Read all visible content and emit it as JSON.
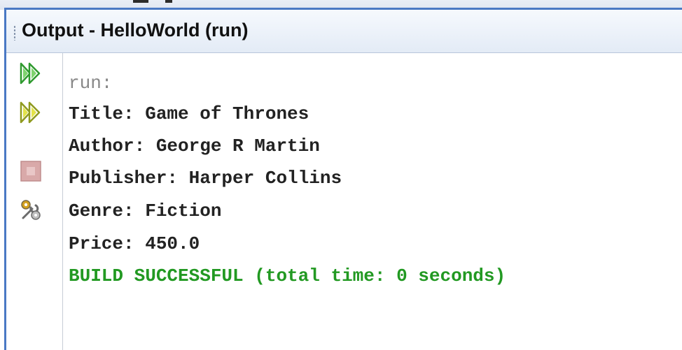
{
  "window": {
    "title": "Output - HelloWorld (run)"
  },
  "toolbar": {
    "rerun_icon": "double-chevron-right-green",
    "rerun_with_params_icon": "double-chevron-right-yellow",
    "stop_icon": "stop-square",
    "settings_icon": "wrench-gear"
  },
  "console": {
    "lines": [
      "run:",
      "Title: Game of Thrones",
      "Author: George R Martin",
      "Publisher: Harper Collins",
      "Genre: Fiction",
      "Price: 450.0",
      "BUILD SUCCESSFUL (total time: 0 seconds)"
    ]
  },
  "colors": {
    "frame": "#4a79c4",
    "run_text": "#888888",
    "output_text": "#222222",
    "success_text": "#229922"
  }
}
